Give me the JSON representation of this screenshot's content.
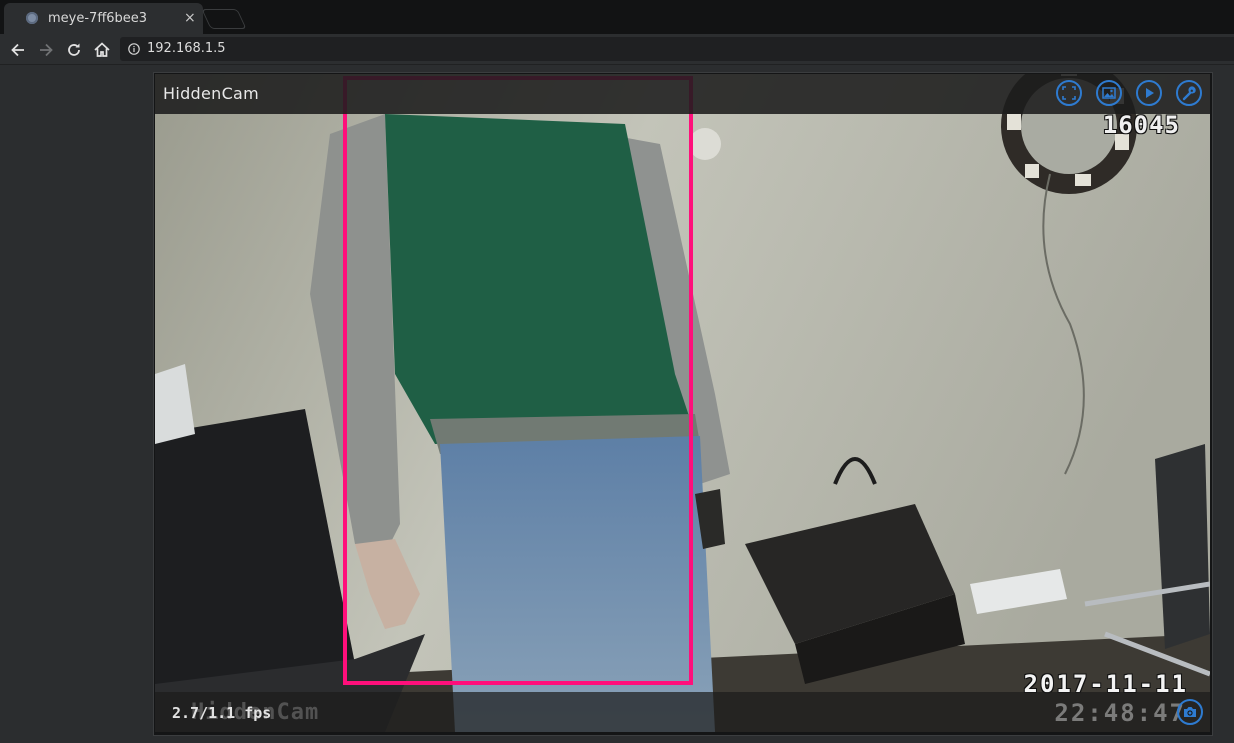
{
  "browser": {
    "tab_title": "meye-7ff6bee3",
    "tab_close": "×",
    "url": "192.168.1.5"
  },
  "camera": {
    "name": "HiddenCam",
    "fps": "2.7/1.1 fps",
    "osd_number": "16045",
    "osd_date": "2017-11-11",
    "osd_time": "22:48:47",
    "osd_name": "HiddenCam",
    "buttons": [
      "fullscreen-icon",
      "pictures-icon",
      "play-icon",
      "wrench-icon"
    ],
    "accent_color": "#2e7bd0",
    "motion_box_color": "#ff0f7b"
  }
}
